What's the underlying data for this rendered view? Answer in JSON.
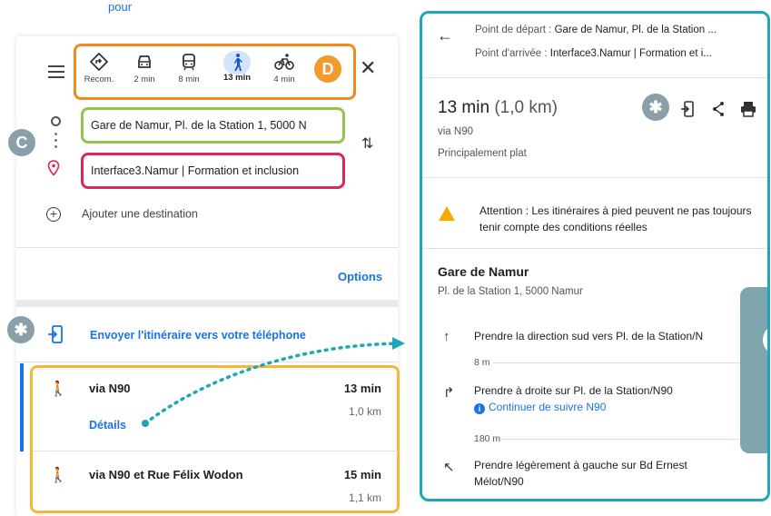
{
  "top_label": "pour",
  "left": {
    "modes": [
      {
        "label": "Recom.",
        "icon": "route-icon"
      },
      {
        "label": "2 min",
        "icon": "car-icon"
      },
      {
        "label": "8 min",
        "icon": "transit-icon"
      },
      {
        "label": "13 min",
        "icon": "walk-icon"
      },
      {
        "label": "4 min",
        "icon": "bike-icon"
      }
    ],
    "origin": "Gare de Namur, Pl. de la Station 1, 5000 N",
    "destination": "Interface3.Namur | Formation et inclusion",
    "add_destination": "Ajouter une destination",
    "options": "Options",
    "send_to_phone": "Envoyer l'itinéraire vers votre téléphone",
    "routes": [
      {
        "name": "via N90",
        "time": "13 min",
        "distance": "1,0 km",
        "details": "Détails"
      },
      {
        "name": "via N90 et Rue Félix Wodon",
        "time": "15 min",
        "distance": "1,1 km"
      }
    ]
  },
  "badges": {
    "d": "D",
    "c": "C"
  },
  "right": {
    "start_label": "Point de départ : ",
    "start_value": "Gare de Namur, Pl. de la Station ...",
    "end_label": "Point d'arrivée : ",
    "end_value": "Interface3.Namur | Formation et i...",
    "duration": "13 min",
    "distance": "(1,0 km)",
    "via": "via N90",
    "terrain": "Principalement plat",
    "warning": "Attention : Les itinéraires à pied peuvent ne pas toujours tenir compte des conditions réelles",
    "place_title": "Gare de Namur",
    "place_address": "Pl. de la Station 1, 5000 Namur",
    "steps": [
      {
        "text": "Prendre la direction sud vers Pl. de la Station/N",
        "icon": "arrow-up-icon"
      },
      {
        "text": "Prendre à droite sur Pl. de la Station/N90",
        "icon": "turn-right-icon"
      },
      {
        "text": "Prendre légèrement à gauche sur Bd Ernest",
        "text2": "Mélot/N90",
        "icon": "slight-left-icon"
      }
    ],
    "step_distances": [
      "8 m",
      "180 m"
    ],
    "continue_link": "Continuer de suivre N90"
  },
  "colors": {
    "mode_box": "#f08a1e",
    "origin_box": "#8fc54a",
    "dest_box": "#e0245e",
    "routes_box": "#f5b63b",
    "right_panel": "#1ea7b8",
    "accent": "#1a73e8"
  }
}
